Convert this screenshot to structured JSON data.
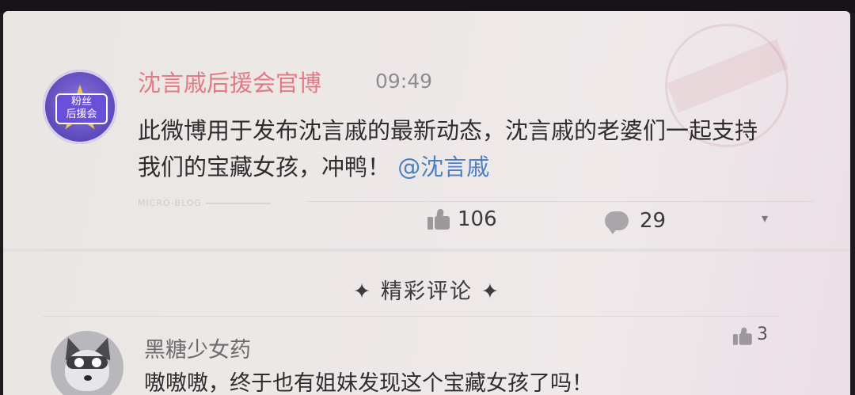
{
  "post": {
    "author": "沈言戚后援会官博",
    "time": "09:49",
    "avatar_badge_line1": "粉丝",
    "avatar_badge_line2": "后援会",
    "text_before_mention": "此微博用于发布沈言戚的最新动态，沈言戚的老婆们一起支持我们的宝藏女孩，冲鸭！",
    "mention": "@沈言戚",
    "watermark": "MICRO-BLOG",
    "likes": "106",
    "comments": "29",
    "more_icon": "▾"
  },
  "comments_section": {
    "title": "✦ 精彩评论 ✦"
  },
  "comments": [
    {
      "user": "黑糖少女药",
      "text": "嗷嗷嗷，终于也有姐妹发现这个宝藏女孩了吗！",
      "likes": "3"
    }
  ],
  "icons": {
    "like": "thumbs-up-icon",
    "comment": "comment-bubble-icon",
    "more": "chevron-down-icon"
  },
  "colors": {
    "author": "#e27a86",
    "mention": "#4a7fc4"
  }
}
